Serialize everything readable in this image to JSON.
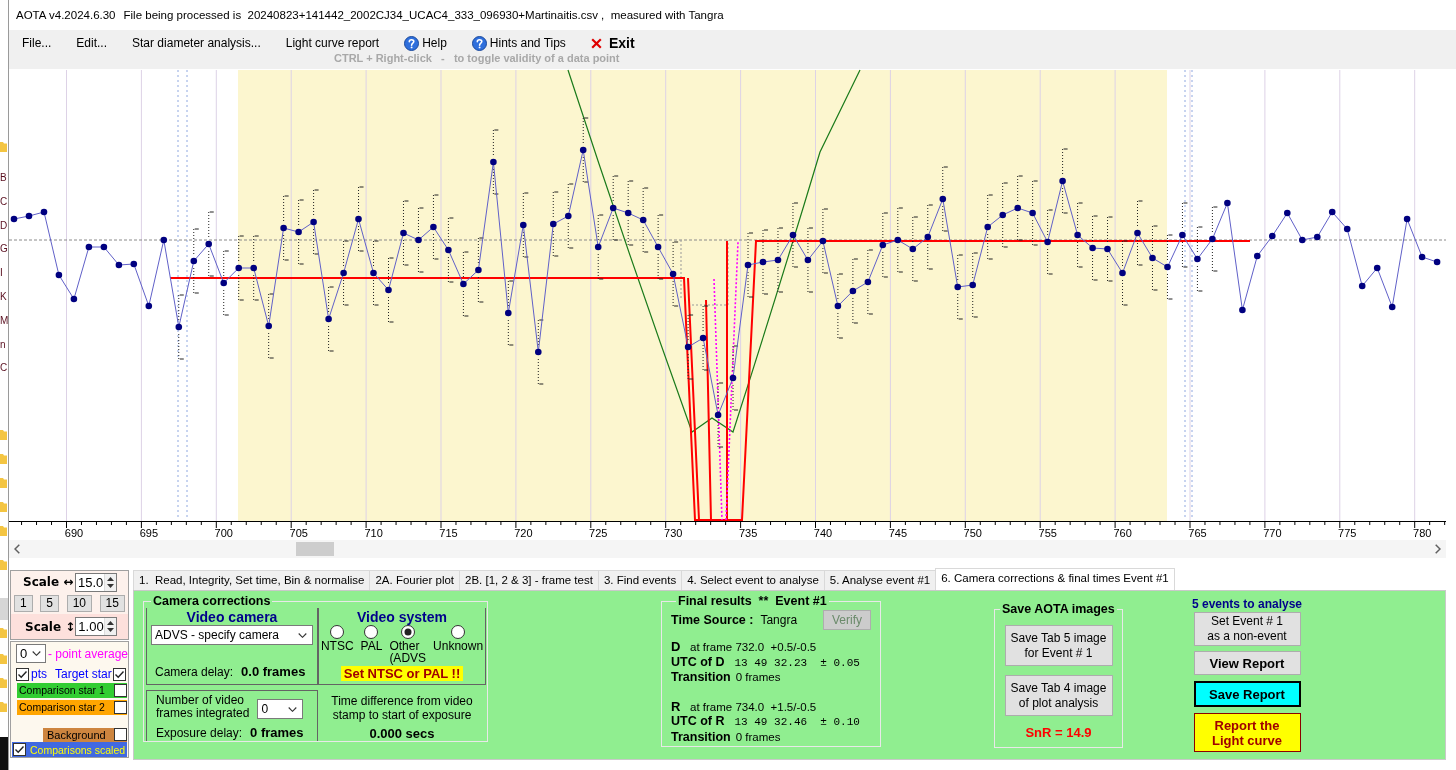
{
  "window": {
    "app_name": "AOTA v4.2024.6.30",
    "file_info": "File being processed is  20240823+141442_2002CJ34_UCAC4_333_096930+Martinaitis.csv ,  measured with Tangra"
  },
  "background_window": {
    "letters": [
      "B",
      "C",
      "D",
      "G",
      "I",
      "K",
      "M",
      "n",
      "C"
    ]
  },
  "menu": {
    "items": [
      {
        "kind": "plain",
        "label": "File..."
      },
      {
        "kind": "plain",
        "label": "Edit..."
      },
      {
        "kind": "plain",
        "label": "Star diameter analysis..."
      },
      {
        "kind": "plain",
        "label": "Light curve report"
      },
      {
        "kind": "help",
        "label": "Help"
      },
      {
        "kind": "help",
        "label": "Hints and Tips"
      },
      {
        "kind": "exit",
        "label": "Exit"
      }
    ],
    "hint": "CTRL + Right-click   -   to toggle validity of a data point"
  },
  "plot": {
    "x_ticks": [
      "690",
      "695",
      "700",
      "705",
      "710",
      "715",
      "720",
      "725",
      "730",
      "735",
      "740",
      "745",
      "750",
      "755",
      "760",
      "765",
      "770",
      "775",
      "780"
    ]
  },
  "scale_panel": {
    "horizontal_label": "Scale ↔",
    "horizontal_value": "15.0",
    "presets": [
      "1",
      "5",
      "10",
      "15"
    ],
    "vertical_label": "Scale ↕",
    "vertical_value": "1.00"
  },
  "series_panel": {
    "average": {
      "value": "0",
      "label": "- point average"
    },
    "points": {
      "label": "pts",
      "checked": true
    },
    "series": [
      {
        "kind": "text",
        "label": "Target star",
        "color": "#0000ff",
        "checked": true
      },
      {
        "kind": "band",
        "label": "Comparison star 1",
        "color": "#32cd32",
        "checked": false
      },
      {
        "kind": "band",
        "label": "Comparison star 2",
        "color": "#ffa500",
        "checked": false
      },
      {
        "kind": "inset",
        "label": "Background",
        "color": "#cd853f",
        "checked": false
      }
    ],
    "scaled": {
      "label": "Comparisons scaled",
      "checked": true
    }
  },
  "tabs": [
    {
      "label": "1.  Read, Integrity, Set time, Bin & normalise",
      "selected": false
    },
    {
      "label": "2A. Fourier plot",
      "selected": false
    },
    {
      "label": "2B. [1, 2 & 3] - frame test",
      "selected": false
    },
    {
      "label": "3. Find events",
      "selected": false
    },
    {
      "label": "4. Select event to analyse",
      "selected": false
    },
    {
      "label": "5. Analyse event #1",
      "selected": false
    },
    {
      "label": "6. Camera corrections & final times Event #1",
      "selected": true
    }
  ],
  "camera_corrections": {
    "title": "Camera corrections",
    "video_camera": {
      "title": "Video camera",
      "camera": "ADVS - specify camera",
      "delay_label": "Camera delay:",
      "delay": "0.0 frames"
    },
    "video_system": {
      "title": "Video system",
      "options": [
        {
          "label": "NTSC",
          "selected": false
        },
        {
          "label": "PAL",
          "selected": false
        },
        {
          "label": "Other\n(ADVS",
          "selected": true
        },
        {
          "label": "Unknown",
          "selected": false
        }
      ],
      "warning": "Set NTSC or PAL !!"
    },
    "integration": {
      "label": "Number of video\nframes integrated",
      "frames": "0",
      "delay_label": "Exposure delay:",
      "delay": "0 frames"
    },
    "time_offset": {
      "label": "Time difference from video\nstamp to start of exposure",
      "value": "0.000 secs"
    }
  },
  "final_results": {
    "title": "Final results  **  Event #1",
    "time_source_label": "Time Source :",
    "time_source": "Tangra",
    "verify": {
      "label": "Verify",
      "disabled": true
    },
    "events": [
      {
        "letter": "D",
        "frame": "at frame 732.0  +0.5/-0.5",
        "utc_label": "UTC of D",
        "utc": "13 49 32.23  ± 0.05",
        "transition_label": "Transition",
        "transition": "0 frames"
      },
      {
        "letter": "R",
        "frame": "at frame 734.0  +1.5/-0.5",
        "utc_label": "UTC of R",
        "utc": "13 49 32.46  ± 0.10",
        "transition_label": "Transition",
        "transition": "0 frames"
      }
    ]
  },
  "save_images": {
    "title": "Save AOTA images",
    "buttons": [
      "Save Tab 5 image\nfor Event # 1",
      "Save Tab 4 image\nof plot analysis"
    ],
    "snr": "SnR = 14.9"
  },
  "event_actions": {
    "title": "5 events to analyse",
    "buttons": [
      {
        "kind": "plain",
        "label": "Set Event # 1\nas a non-event"
      },
      {
        "kind": "bold",
        "label": "View Report"
      },
      {
        "kind": "save",
        "label": "Save Report"
      },
      {
        "kind": "report",
        "label": "Report the\nLight curve"
      }
    ]
  }
}
